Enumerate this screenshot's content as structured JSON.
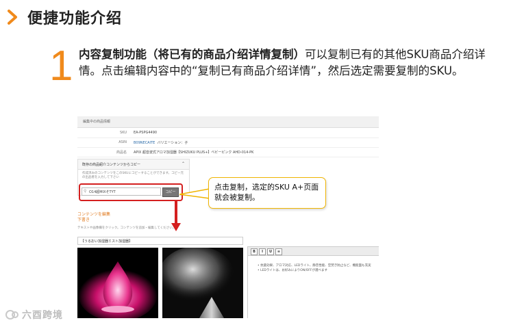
{
  "header": {
    "title": "便捷功能介绍"
  },
  "step": {
    "number": "1",
    "bold": "内容复制功能（将已有的商品介绍详情复制）",
    "text": "可以复制已有的其他SKU商品介绍详情。点击编辑内容中的“复制已有商品介绍详情”，然后选定需要复制的SKU。"
  },
  "screenshot": {
    "bar_label": "編集中の商品情報",
    "rows": [
      {
        "label": "SKU",
        "value": "EA-PSPG4490",
        "extra": ""
      },
      {
        "label": "ASIN",
        "value": "B09NECAITE",
        "extra": "バリエーション：子"
      },
      {
        "label": "商品名",
        "value": "APIX 超音波式アロマ加湿器【SHIZUKU PLUS+】ベビーピンク AHD-014-PK",
        "extra": ""
      }
    ],
    "panel_title": "既存の商品紹介コンテンツからコピー",
    "panel_desc": "作成済みのコンテンツをこのSKUにコピーすることができます。コピー元の出品者を入力して下さい",
    "search_value": "O14超MIXそTYT",
    "copy_button": "コピー",
    "section_title": "コンテンツを編集",
    "section_sub": "下書き",
    "note": "テキストや画像欄をクリック。コンテンツを追加・編集してください。",
    "title_field": "【うるおい加湿器ミスト加湿器】",
    "toolbar": [
      "B",
      "I",
      "U"
    ],
    "bullets": [
      "• 抗菌効果、アロマ対応、LEDライト、静音性能、空焚き防止など、機能面も充実",
      "• LEDライトは、お好みによりON/OFFが選べます"
    ]
  },
  "callout": {
    "text": "点击复制，选定的SKU A+页面就会被复制。"
  },
  "watermark": {
    "text": "六酉跨境"
  },
  "colors": {
    "accent": "#f08a1c",
    "highlight": "#d41f1f",
    "callout_border": "#f0b400"
  }
}
